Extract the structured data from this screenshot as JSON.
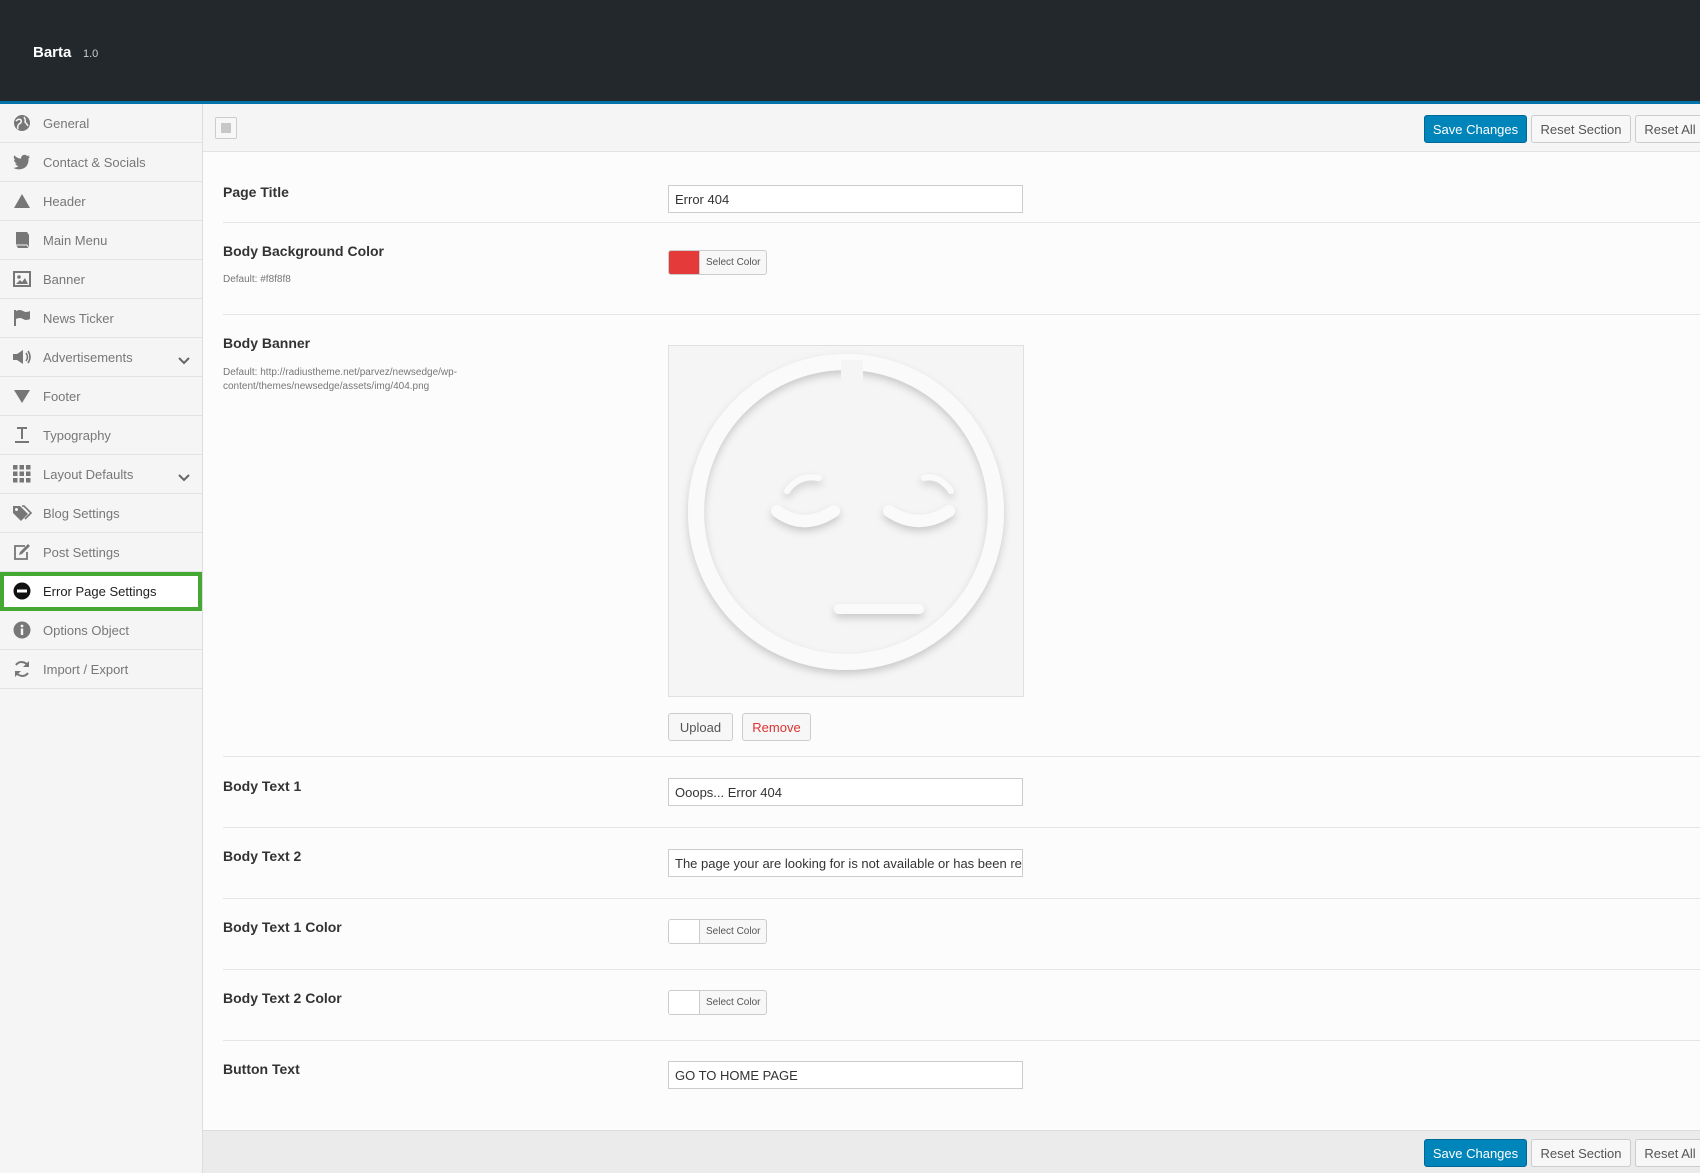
{
  "app": {
    "name": "Barta",
    "version": "1.0"
  },
  "sidebar": {
    "items": [
      {
        "label": "General",
        "icon": "globe-icon"
      },
      {
        "label": "Contact & Socials",
        "icon": "twitter-icon"
      },
      {
        "label": "Header",
        "icon": "triangle-up-icon"
      },
      {
        "label": "Main Menu",
        "icon": "book-icon"
      },
      {
        "label": "Banner",
        "icon": "image-icon"
      },
      {
        "label": "News Ticker",
        "icon": "flag-icon"
      },
      {
        "label": "Advertisements",
        "icon": "megaphone-icon"
      },
      {
        "label": "Footer",
        "icon": "triangle-down-icon"
      },
      {
        "label": "Typography",
        "icon": "text-icon"
      },
      {
        "label": "Layout Defaults",
        "icon": "grid-icon"
      },
      {
        "label": "Blog Settings",
        "icon": "tags-icon"
      },
      {
        "label": "Post Settings",
        "icon": "edit-icon"
      },
      {
        "label": "Error Page Settings",
        "icon": "minus-circle-icon"
      },
      {
        "label": "Options Object",
        "icon": "info-icon"
      },
      {
        "label": "Import / Export",
        "icon": "refresh-icon"
      }
    ],
    "active": "Error Page Settings"
  },
  "toolbar": {
    "save_label": "Save Changes",
    "reset_section_label": "Reset Section",
    "reset_all_label": "Reset All"
  },
  "fields": {
    "page_title": {
      "label": "Page Title",
      "value": "Error 404"
    },
    "body_bg_color": {
      "label": "Body Background Color",
      "desc": "Default: #f8f8f8",
      "button_label": "Select Color",
      "color": "#e43a3a"
    },
    "body_banner": {
      "label": "Body Banner",
      "desc": "Default: http://radiustheme.net/parvez/newsedge/wp-content/themes/newsedge/assets/img/404.png",
      "upload_label": "Upload",
      "remove_label": "Remove"
    },
    "body_text_1": {
      "label": "Body Text 1",
      "value": "Ooops... Error 404"
    },
    "body_text_2": {
      "label": "Body Text 2",
      "value": "The page your are looking for is not available or has been removed"
    },
    "body_text_1_color": {
      "label": "Body Text 1 Color",
      "button_label": "Select Color",
      "color": "#ffffff"
    },
    "body_text_2_color": {
      "label": "Body Text 2 Color",
      "button_label": "Select Color",
      "color": "#ffffff"
    },
    "button_text": {
      "label": "Button Text",
      "value": "GO TO HOME PAGE"
    }
  },
  "colors": {
    "primary": "#0085ba",
    "topbar": "#23282d",
    "active_outline": "#45a832",
    "remove": "#dc3232"
  }
}
